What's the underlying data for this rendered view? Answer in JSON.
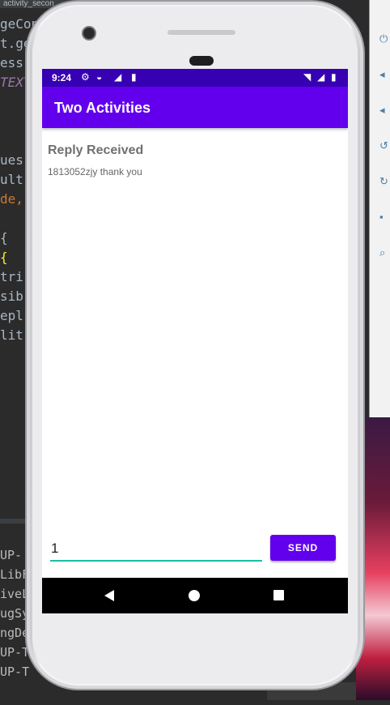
{
  "ide": {
    "tab_label": "activity_secon",
    "code_lines": [
      "geCon",
      "t.ge",
      "ess",
      "TEXT",
      "",
      "",
      "ues",
      "ult",
      "de,",
      "",
      " {",
      " {",
      "tri",
      "sib",
      "epl",
      "lit"
    ],
    "bottom_lines": [
      " UP-",
      "LibF",
      "iveL",
      "ugSy",
      "ngDe",
      "UP-T",
      " UP-T"
    ]
  },
  "status_bar": {
    "time": "9:24"
  },
  "app_bar": {
    "title": "Two Activities"
  },
  "content": {
    "reply_header": "Reply Received",
    "reply_message": "1813052zjy thank you"
  },
  "compose": {
    "input_value": "1",
    "send_label": "SEND"
  },
  "colors": {
    "status_bar": "#3700b3",
    "app_bar": "#6200ee",
    "send_button": "#6200ee",
    "input_underline": "#1bbfa5"
  }
}
